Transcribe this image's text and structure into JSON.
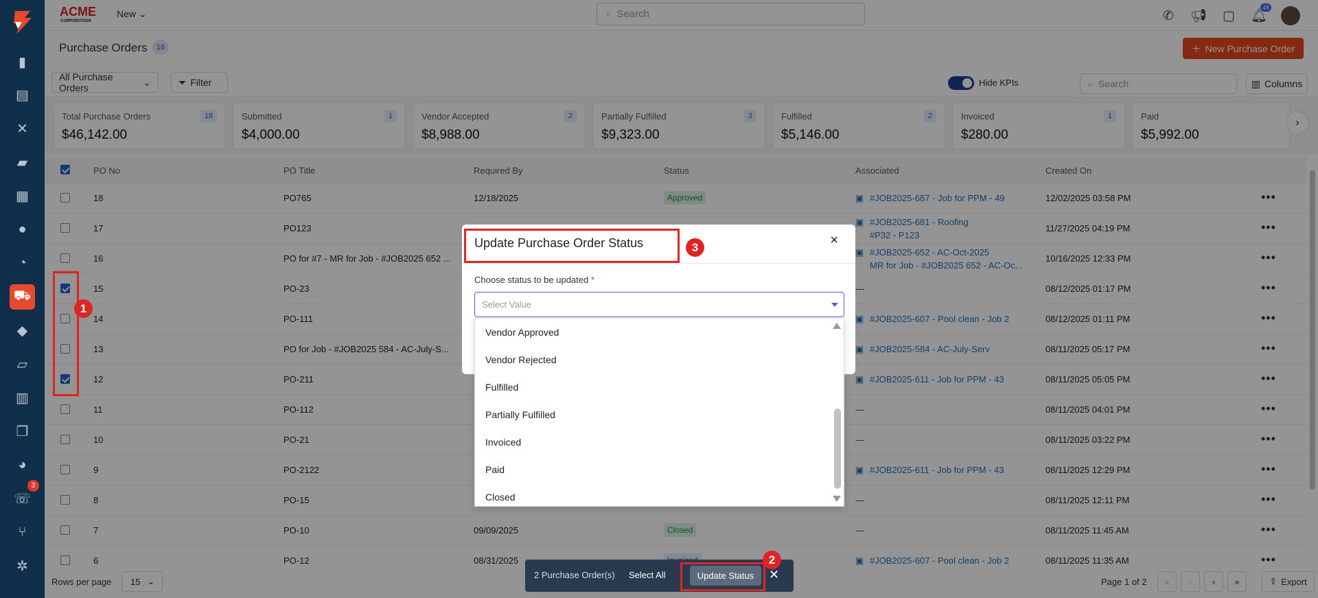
{
  "topbar": {
    "brand": "ACME",
    "brand_sub": "CORPORATION",
    "new_label": "New",
    "search_placeholder": "Search",
    "notification_count": "48"
  },
  "sidebar": {
    "items": [
      "dashboard-icon",
      "reports-icon",
      "tools-icon",
      "briefcase-icon",
      "calendar-icon",
      "users-icon",
      "clock-icon",
      "cart-icon",
      "tag-icon",
      "map-icon",
      "invoice-icon",
      "documents-icon",
      "chart-icon",
      "phone-icon",
      "branch-icon",
      "settings-icon"
    ],
    "active": "cart-icon",
    "phone_badge": "3"
  },
  "page": {
    "title": "Purchase Orders",
    "count": "18",
    "new_button": "New Purchase Order",
    "view_selector": "All Purchase Orders",
    "filter_label": "Filter",
    "hide_kpis_label": "Hide KPIs",
    "search_placeholder": "Search",
    "columns_label": "Columns"
  },
  "kpis": [
    {
      "label": "Total Purchase Orders",
      "value": "$46,142.00",
      "count": "18"
    },
    {
      "label": "Submitted",
      "value": "$4,000.00",
      "count": "1"
    },
    {
      "label": "Vendor Accepted",
      "value": "$8,988.00",
      "count": "2"
    },
    {
      "label": "Partially Fulfilled",
      "value": "$9,323.00",
      "count": "3"
    },
    {
      "label": "Fulfilled",
      "value": "$5,146.00",
      "count": "2"
    },
    {
      "label": "Invoiced",
      "value": "$280.00",
      "count": "1"
    },
    {
      "label": "Paid",
      "value": "$5,992.00",
      "count": ""
    }
  ],
  "table": {
    "headers": [
      "PO No",
      "PO Title",
      "Required By",
      "Status",
      "Associated",
      "Created On"
    ],
    "rows": [
      {
        "no": "18",
        "title": "PO765",
        "required": "12/18/2025",
        "status": "Approved",
        "assoc": [
          "#JOB2025-687 - Job for PPM - 49"
        ],
        "created": "12/02/2025 03:58 PM",
        "checked": false
      },
      {
        "no": "17",
        "title": "PO123",
        "required": "",
        "status": "",
        "assoc": [
          "#JOB2025-681 - Roofing",
          "#P32 - P123"
        ],
        "created": "11/27/2025 04:19 PM",
        "checked": false
      },
      {
        "no": "16",
        "title": "PO for #7 - MR for Job - #JOB2025 652 ...",
        "required": "",
        "status": "",
        "assoc": [
          "#JOB2025-652 - AC-Oct-2025",
          "MR for Job - #JOB2025 652 - AC-Oc..."
        ],
        "created": "10/16/2025 12:33 PM",
        "checked": false
      },
      {
        "no": "15",
        "title": "PO-23",
        "required": "",
        "status": "",
        "assoc": [
          "---"
        ],
        "created": "08/12/2025 01:17 PM",
        "checked": true
      },
      {
        "no": "14",
        "title": "PO-111",
        "required": "",
        "status": "",
        "assoc": [
          "#JOB2025-607 - Pool clean - Job 2"
        ],
        "created": "08/12/2025 01:11 PM",
        "checked": false
      },
      {
        "no": "13",
        "title": "PO for Job - #JOB2025 584 - AC-July-S...",
        "required": "",
        "status": "",
        "assoc": [
          "#JOB2025-584 - AC-July-Serv"
        ],
        "created": "08/11/2025 05:17 PM",
        "checked": false
      },
      {
        "no": "12",
        "title": "PO-211",
        "required": "",
        "status": "",
        "assoc": [
          "#JOB2025-611 - Job for PPM - 43"
        ],
        "created": "08/11/2025 05:05 PM",
        "checked": true
      },
      {
        "no": "11",
        "title": "PO-112",
        "required": "",
        "status": "",
        "assoc": [
          "---"
        ],
        "created": "08/11/2025 04:01 PM",
        "checked": false
      },
      {
        "no": "10",
        "title": "PO-21",
        "required": "",
        "status": "",
        "assoc": [
          "---"
        ],
        "created": "08/11/2025 03:22 PM",
        "checked": false
      },
      {
        "no": "9",
        "title": "PO-2122",
        "required": "",
        "status": "",
        "assoc": [
          "#JOB2025-611 - Job for PPM - 43"
        ],
        "created": "08/11/2025 12:29 PM",
        "checked": false
      },
      {
        "no": "8",
        "title": "PO-15",
        "required": "",
        "status": "",
        "assoc": [
          "---"
        ],
        "created": "08/11/2025 12:11 PM",
        "checked": false
      },
      {
        "no": "7",
        "title": "PO-10",
        "required": "09/09/2025",
        "status": "Closed",
        "assoc": [
          "---"
        ],
        "created": "08/11/2025 11:45 AM",
        "checked": false
      },
      {
        "no": "6",
        "title": "PO-12",
        "required": "08/31/2025",
        "status": "Invoiced",
        "assoc": [
          "#JOB2025-607 - Pool clean - Job 2"
        ],
        "created": "08/11/2025 11:35 AM",
        "checked": false
      }
    ]
  },
  "modal": {
    "title": "Update Purchase Order Status",
    "close": "×",
    "field_label": "Choose status to be updated",
    "required_mark": "*",
    "placeholder": "Select Value",
    "options": [
      "Vendor Approved",
      "Vendor Rejected",
      "Fulfilled",
      "Partially Fulfilled",
      "Invoiced",
      "Paid",
      "Closed"
    ]
  },
  "footer": {
    "rows_per_page_label": "Rows per page",
    "rows_per_page": "15",
    "page_info": "Page 1 of 2",
    "export_label": "Export"
  },
  "bulk_bar": {
    "selected": "2 Purchase Order(s)",
    "select_all": "Select All",
    "update_status": "Update Status",
    "close": "✕"
  },
  "annotations": [
    "1",
    "2",
    "3"
  ],
  "colors": {
    "accent": "#e3491f",
    "sidebar": "#0f2f4a",
    "link": "#1e6fb8",
    "annotation": "#e02424"
  }
}
